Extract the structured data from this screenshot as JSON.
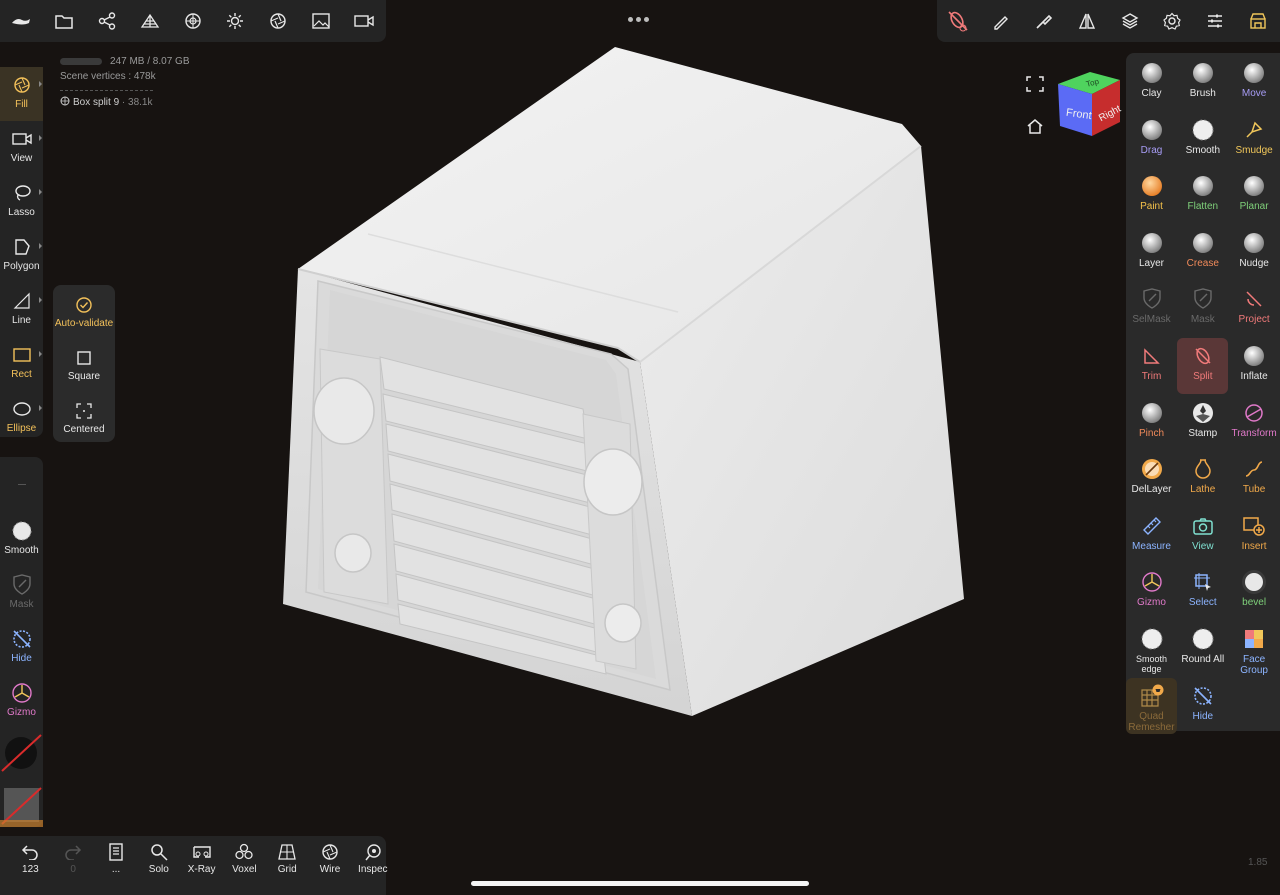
{
  "info": {
    "memory": "247 MB / 8.07 GB",
    "scene_vertices": "Scene vertices : 478k",
    "object_name": "Box split 9",
    "object_count": "· 38.1k"
  },
  "left_tools": [
    {
      "label": "Fill",
      "icon": "fill-icon",
      "active": true
    },
    {
      "label": "View",
      "icon": "camera-icon"
    },
    {
      "label": "Lasso",
      "icon": "lasso-icon"
    },
    {
      "label": "Polygon",
      "icon": "polygon-icon"
    },
    {
      "label": "Line",
      "icon": "line-icon"
    },
    {
      "label": "Rect",
      "icon": "rect-icon",
      "accent": true
    },
    {
      "label": "Ellipse",
      "icon": "ellipse-icon",
      "accent": true
    }
  ],
  "left_tools_2": [
    {
      "label": "Smooth",
      "icon": "smooth-icon"
    },
    {
      "label": "Mask",
      "icon": "mask-icon",
      "dim": true
    },
    {
      "label": "Hide",
      "icon": "hide-icon",
      "color": "#8cb4ff"
    },
    {
      "label": "Gizmo",
      "icon": "gizmo-icon",
      "color": "#e079c9"
    }
  ],
  "rect_popup": [
    {
      "label": "Auto-validate",
      "icon": "check-circle-icon",
      "accent": true
    },
    {
      "label": "Square",
      "icon": "square-icon"
    },
    {
      "label": "Centered",
      "icon": "centered-icon"
    }
  ],
  "bottom_tools": [
    {
      "label": "123",
      "icon": "undo-icon"
    },
    {
      "label": "0",
      "icon": "redo-icon",
      "dim": true
    },
    {
      "label": "...",
      "icon": "book-icon"
    },
    {
      "label": "Solo",
      "icon": "solo-icon"
    },
    {
      "label": "X-Ray",
      "icon": "xray-icon"
    },
    {
      "label": "Voxel",
      "icon": "voxel-icon"
    },
    {
      "label": "Grid",
      "icon": "grid-icon"
    },
    {
      "label": "Wire",
      "icon": "wire-icon"
    },
    {
      "label": "Inspec",
      "icon": "inspect-icon"
    }
  ],
  "tools": [
    {
      "label": "Clay",
      "color": "#e8e8e8",
      "icon": "clay-icon"
    },
    {
      "label": "Brush",
      "color": "#e8e8e8",
      "icon": "brush-icon"
    },
    {
      "label": "Move",
      "color": "#a79cf5",
      "icon": "move-icon"
    },
    {
      "label": "Drag",
      "color": "#a79cf5",
      "icon": "drag-icon"
    },
    {
      "label": "Smooth",
      "color": "#e8e8e8",
      "icon": "smooth-icon"
    },
    {
      "label": "Smudge",
      "color": "#f1c75a",
      "icon": "smudge-icon"
    },
    {
      "label": "Paint",
      "color": "#f4c14a",
      "icon": "paint-icon"
    },
    {
      "label": "Flatten",
      "color": "#7fd07a",
      "icon": "flatten-icon"
    },
    {
      "label": "Planar",
      "color": "#7fd07a",
      "icon": "planar-icon"
    },
    {
      "label": "Layer",
      "color": "#e8e8e8",
      "icon": "layer-icon"
    },
    {
      "label": "Crease",
      "color": "#f08a5a",
      "icon": "crease-icon"
    },
    {
      "label": "Nudge",
      "color": "#e8e8e8",
      "icon": "nudge-icon"
    },
    {
      "label": "SelMask",
      "color": "#6a6a6a",
      "icon": "selmask-icon"
    },
    {
      "label": "Mask",
      "color": "#6a6a6a",
      "icon": "mask-icon"
    },
    {
      "label": "Project",
      "color": "#f07a7a",
      "icon": "project-icon"
    },
    {
      "label": "Trim",
      "color": "#f07a7a",
      "icon": "trim-icon"
    },
    {
      "label": "Split",
      "color": "#f07a7a",
      "icon": "split-icon",
      "selected": true
    },
    {
      "label": "Inflate",
      "color": "#e8e8e8",
      "icon": "inflate-icon"
    },
    {
      "label": "Pinch",
      "color": "#f08a5a",
      "icon": "pinch-icon"
    },
    {
      "label": "Stamp",
      "color": "#e8e8e8",
      "icon": "stamp-icon"
    },
    {
      "label": "Transform",
      "color": "#e079c9",
      "icon": "transform-icon"
    },
    {
      "label": "DelLayer",
      "color": "#e8e8e8",
      "icon": "dellayer-icon"
    },
    {
      "label": "Lathe",
      "color": "#f1a94a",
      "icon": "lathe-icon"
    },
    {
      "label": "Tube",
      "color": "#f1a94a",
      "icon": "tube-icon"
    },
    {
      "label": "Measure",
      "color": "#8cb4ff",
      "icon": "measure-icon"
    },
    {
      "label": "View",
      "color": "#7fe0d0",
      "icon": "view-icon"
    },
    {
      "label": "Insert",
      "color": "#f1a94a",
      "icon": "insert-icon"
    },
    {
      "label": "Gizmo",
      "color": "#e079c9",
      "icon": "gizmo-icon"
    },
    {
      "label": "Select",
      "color": "#8cb4ff",
      "icon": "select-icon"
    },
    {
      "label": "bevel",
      "color": "#7fd07a",
      "icon": "bevel-icon"
    },
    {
      "label": "Smooth edge",
      "color": "#e8e8e8",
      "icon": "smooth-edge-icon"
    },
    {
      "label": "Round All",
      "color": "#e8e8e8",
      "icon": "round-all-icon"
    },
    {
      "label": "Face Group",
      "color": "#8cb4ff",
      "icon": "face-group-icon"
    },
    {
      "label": "Quad\nRemesher",
      "color": "#8a6a3a",
      "icon": "quad-remesher-icon"
    },
    {
      "label": "Hide",
      "color": "#8cb4ff",
      "icon": "hide-icon"
    }
  ],
  "cube": {
    "front": "Front",
    "right": "Right",
    "top": "Top"
  },
  "version": "1.85"
}
